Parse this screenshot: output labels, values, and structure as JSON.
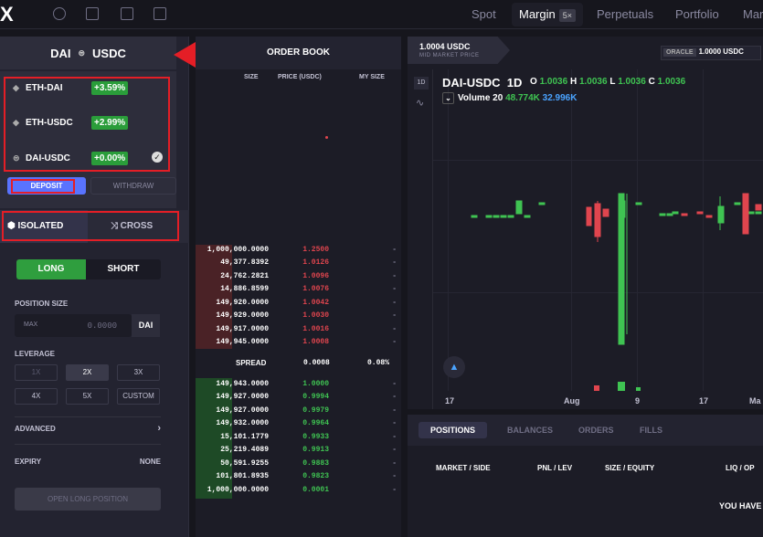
{
  "topbar": {
    "logo": "X",
    "nav": [
      "Spot",
      "Margin",
      "Perpetuals",
      "Portfolio",
      "Mar"
    ],
    "active": "Margin",
    "margin_badge": "5×"
  },
  "pair_header": {
    "base": "DAI",
    "quote": "USDC"
  },
  "markets": [
    {
      "name": "ETH-DAI",
      "change": "+3.59%",
      "icon": "eth-icon"
    },
    {
      "name": "ETH-USDC",
      "change": "+2.99%",
      "icon": "eth-icon"
    },
    {
      "name": "DAI-USDC",
      "change": "+0.00%",
      "icon": "dai-icon",
      "selected": true
    }
  ],
  "funds": {
    "deposit": "DEPOSIT",
    "withdraw": "WITHDRAW"
  },
  "margin_mode": {
    "isolated": "ISOLATED",
    "cross": "CROSS"
  },
  "side": {
    "long": "LONG",
    "short": "SHORT"
  },
  "position_size": {
    "label": "POSITION SIZE",
    "max": "MAX",
    "placeholder": "0.0000",
    "asset": "DAI"
  },
  "leverage": {
    "label": "LEVERAGE",
    "options": [
      "1X",
      "2X",
      "3X",
      "4X",
      "5X",
      "CUSTOM"
    ],
    "selected": "2X"
  },
  "advanced": {
    "label": "ADVANCED",
    "chevron": "›"
  },
  "expiry": {
    "label": "EXPIRY",
    "value": "NONE"
  },
  "open_button": "OPEN LONG POSITION",
  "orderbook": {
    "title": "ORDER BOOK",
    "headers": {
      "size": "SIZE",
      "price": "PRICE (USDC)",
      "mine": "MY SIZE"
    },
    "asks": [
      {
        "size": "1,000,000.0000",
        "price": "1.2500",
        "mine": "-"
      },
      {
        "size": "49,377.8392",
        "price": "1.0126",
        "mine": "-"
      },
      {
        "size": "24,762.2821",
        "price": "1.0096",
        "mine": "-"
      },
      {
        "size": "14,886.8599",
        "price": "1.0076",
        "mine": "-"
      },
      {
        "size": "149,920.0000",
        "price": "1.0042",
        "mine": "-"
      },
      {
        "size": "149,929.0000",
        "price": "1.0030",
        "mine": "-"
      },
      {
        "size": "149,917.0000",
        "price": "1.0016",
        "mine": "-"
      },
      {
        "size": "149,945.0000",
        "price": "1.0008",
        "mine": "-"
      }
    ],
    "spread": {
      "label": "SPREAD",
      "value": "0.0008",
      "pct": "0.08%"
    },
    "bids": [
      {
        "size": "149,943.0000",
        "price": "1.0000",
        "mine": "-"
      },
      {
        "size": "149,927.0000",
        "price": "0.9994",
        "mine": "-"
      },
      {
        "size": "149,927.0000",
        "price": "0.9979",
        "mine": "-"
      },
      {
        "size": "149,932.0000",
        "price": "0.9964",
        "mine": "-"
      },
      {
        "size": "15,101.1779",
        "price": "0.9933",
        "mine": "-"
      },
      {
        "size": "25,219.4089",
        "price": "0.9913",
        "mine": "-"
      },
      {
        "size": "50,591.9255",
        "price": "0.9883",
        "mine": "-"
      },
      {
        "size": "101,801.8935",
        "price": "0.9823",
        "mine": "-"
      },
      {
        "size": "1,000,000.0000",
        "price": "0.0001",
        "mine": "-"
      }
    ]
  },
  "chart": {
    "mid_value": "1.0004 USDC",
    "mid_label": "MID MARKET PRICE",
    "oracle_tag": "ORACLE",
    "oracle_value": "1.0000 USDC",
    "interval": "1D",
    "symbol": "DAI-USDC",
    "symbol_interval": "1D",
    "ohlc": {
      "O": "1.0036",
      "H": "1.0036",
      "L": "1.0036",
      "C": "1.0036"
    },
    "volume": {
      "label": "Volume 20",
      "v1": "48.774K",
      "v2": "32.996K"
    },
    "x_ticks": [
      "17",
      "Aug",
      "9",
      "17",
      "Ma"
    ]
  },
  "positions": {
    "tabs": [
      "POSITIONS",
      "BALANCES",
      "ORDERS",
      "FILLS"
    ],
    "columns": [
      "MARKET / SIDE",
      "PNL / LEV",
      "SIZE / EQUITY",
      "LIQ / OP"
    ],
    "empty": "YOU HAVE"
  }
}
